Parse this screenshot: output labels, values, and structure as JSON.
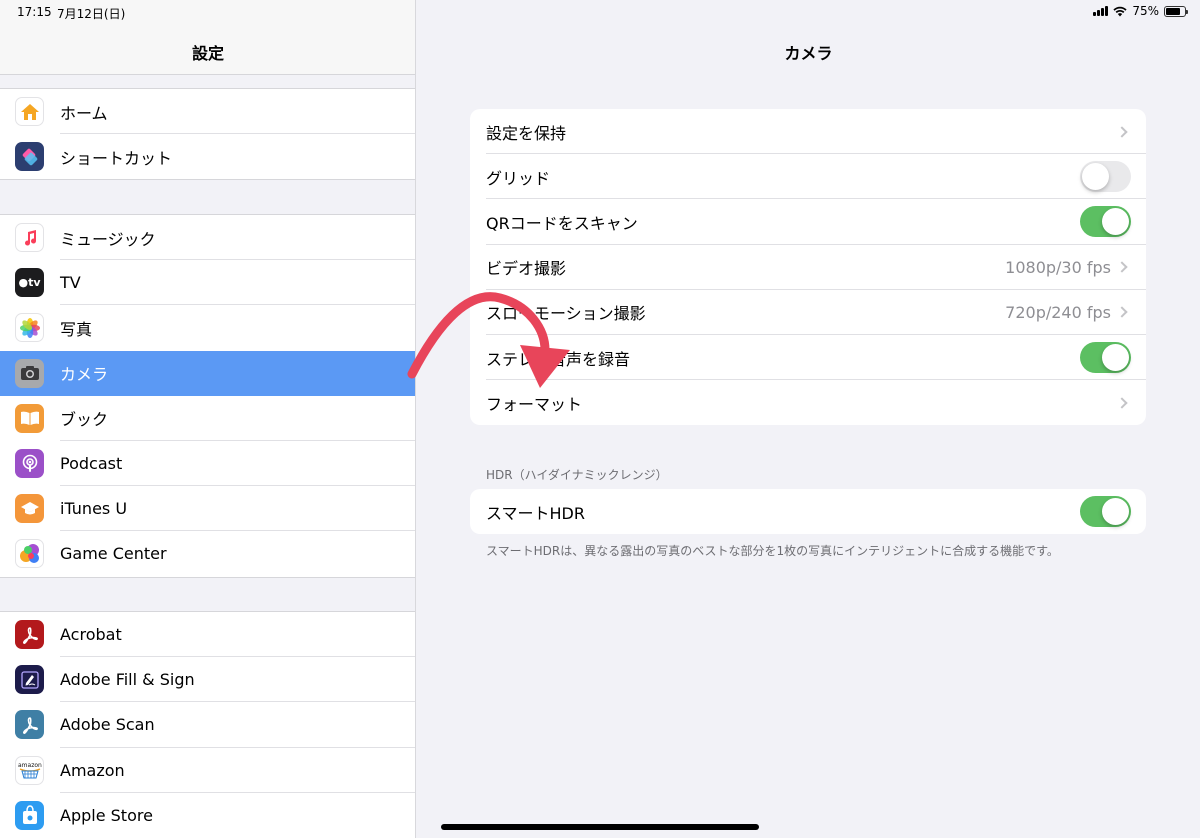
{
  "status_bar": {
    "time": "17:15",
    "date": "7月12日(日)",
    "battery": "75%",
    "battery_level": 0.75
  },
  "sidebar": {
    "title": "設定",
    "groups": [
      [
        {
          "label": "ホーム",
          "icon": "home-icon",
          "color": "#ffffff"
        },
        {
          "label": "ショートカット",
          "icon": "shortcuts-icon",
          "color": "#2c3e70"
        }
      ],
      [
        {
          "label": "ミュージック",
          "icon": "music-icon",
          "color": "#ffffff"
        },
        {
          "label": "TV",
          "icon": "tv-icon",
          "color": "#1c1c1e"
        },
        {
          "label": "写真",
          "icon": "photos-icon",
          "color": "#ffffff"
        },
        {
          "label": "カメラ",
          "icon": "camera-icon",
          "color": "#a7a9ac",
          "selected": true
        },
        {
          "label": "ブック",
          "icon": "books-icon",
          "color": "#f29b38"
        },
        {
          "label": "Podcast",
          "icon": "podcast-icon",
          "color": "#9b50c8"
        },
        {
          "label": "iTunes U",
          "icon": "itunes-u-icon",
          "color": "#f4963a"
        },
        {
          "label": "Game Center",
          "icon": "game-center-icon",
          "color": "#ffffff"
        }
      ],
      [
        {
          "label": "Acrobat",
          "icon": "acrobat-icon",
          "color": "#b3191c"
        },
        {
          "label": "Adobe Fill & Sign",
          "icon": "fill-sign-icon",
          "color": "#1d1c4b"
        },
        {
          "label": "Adobe Scan",
          "icon": "adobe-scan-icon",
          "color": "#3f7fa5"
        },
        {
          "label": "Amazon",
          "icon": "amazon-icon",
          "color": "#ffffff"
        },
        {
          "label": "Apple Store",
          "icon": "apple-store-icon",
          "color": "#2d9cf1"
        }
      ]
    ]
  },
  "detail": {
    "title": "カメラ",
    "rows": [
      {
        "label": "設定を保持",
        "kind": "chevron"
      },
      {
        "label": "グリッド",
        "kind": "toggle",
        "on": false
      },
      {
        "label": "QRコードをスキャン",
        "kind": "toggle",
        "on": true
      },
      {
        "label": "ビデオ撮影",
        "kind": "chevron",
        "value": "1080p/30 fps"
      },
      {
        "label": "スローモーション撮影",
        "kind": "chevron",
        "value": "720p/240 fps"
      },
      {
        "label": "ステレオ音声を録音",
        "kind": "toggle",
        "on": true
      },
      {
        "label": "フォーマット",
        "kind": "chevron"
      }
    ],
    "hdr_header": "HDR（ハイダイナミックレンジ）",
    "hdr_row": {
      "label": "スマートHDR",
      "kind": "toggle",
      "on": true
    },
    "hdr_footer": "スマートHDRは、異なる露出の写真のベストな部分を1枚の写真にインテリジェントに合成する機能です。"
  },
  "colors": {
    "accent_selected": "#5b99f4",
    "toggle_on": "#5cbf62",
    "annotation_arrow": "#e8455a"
  }
}
